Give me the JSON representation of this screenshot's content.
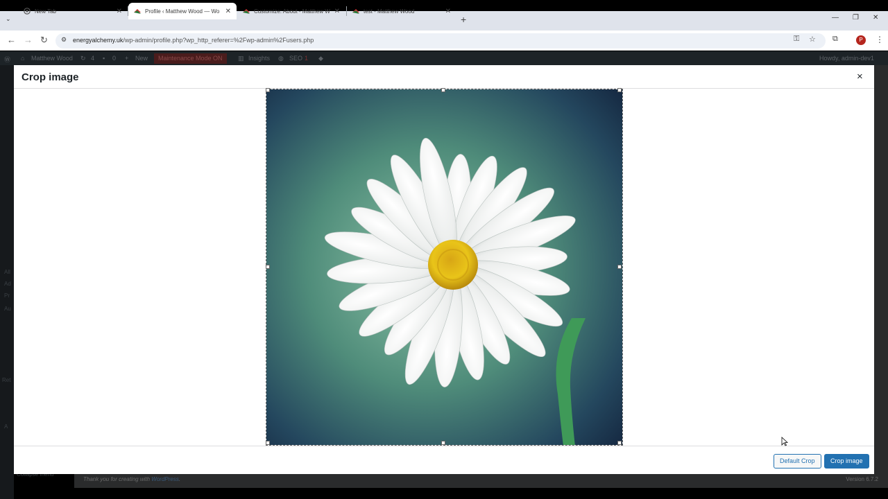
{
  "browser": {
    "tabs": [
      {
        "title": "New Tab",
        "active": false
      },
      {
        "title": "Profile ‹ Matthew Wood — Wo",
        "active": true
      },
      {
        "title": "Customize: About - Matthew W",
        "active": false
      },
      {
        "title": "test - Matthew Wood",
        "active": false
      }
    ],
    "new_tab_glyph": "+",
    "url_domain": "energyalchemy.uk",
    "url_path": "/wp-admin/profile.php?wp_http_referer=%2Fwp-admin%2Fusers.php",
    "profile_initial": "P"
  },
  "wp_admin_bar": {
    "site_name": "Matthew Wood",
    "updates_count": "4",
    "comments_count": "0",
    "new_label": "New",
    "maintenance_label": "Maintenance Mode ON",
    "insights_label": "Insights",
    "seo_label": "SEO",
    "seo_badge": "1",
    "howdy": "Howdy, admin-dev1"
  },
  "wp_footer": {
    "thanks_prefix": "Thank you for creating with ",
    "thanks_link": "WordPress",
    "thanks_suffix": ".",
    "version": "Version 6.7.2"
  },
  "sidebar_labels": [
    "All",
    "Ad",
    "Pr",
    "Au",
    "Ret",
    "A",
    "Collapse menu"
  ],
  "modal": {
    "title": "Crop image",
    "close_glyph": "×",
    "default_crop_label": "Default Crop",
    "crop_button_label": "Crop image"
  },
  "colors": {
    "wp_primary": "#2271b1",
    "admin_bar": "#1d2327"
  }
}
